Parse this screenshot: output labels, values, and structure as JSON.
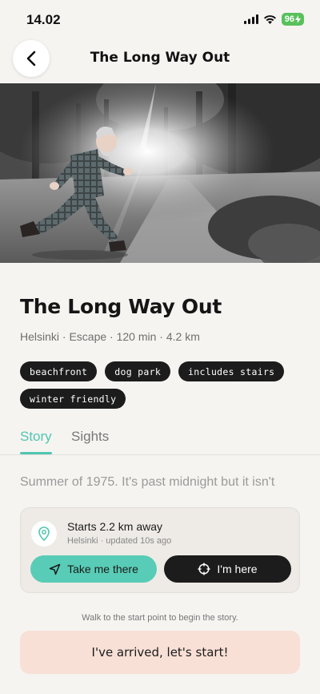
{
  "status": {
    "time": "14.02",
    "battery": "96"
  },
  "nav": {
    "title": "The Long Way Out"
  },
  "story": {
    "title": "The Long Way Out",
    "meta": "Helsinki · Escape · 120 min · 4.2 km",
    "tags": [
      "beachfront",
      "dog park",
      "includes stairs",
      "winter friendly"
    ]
  },
  "tabs": {
    "story": "Story",
    "sights": "Sights"
  },
  "story_text": "Summer of 1975. It's past midnight but it isn't",
  "start_card": {
    "title": "Starts 2.2 km away",
    "subtitle": "Helsinki · updated 10s ago",
    "take_label": "Take me there",
    "here_label": "I'm here"
  },
  "hint": "Walk to the start point to begin the story.",
  "arrived_label": "I've arrived, let's start!",
  "colors": {
    "accent": "#4fc6b0",
    "take_button": "#58ccb6",
    "arrived_bg": "#f8e0d6",
    "dark": "#1c1c1c"
  }
}
